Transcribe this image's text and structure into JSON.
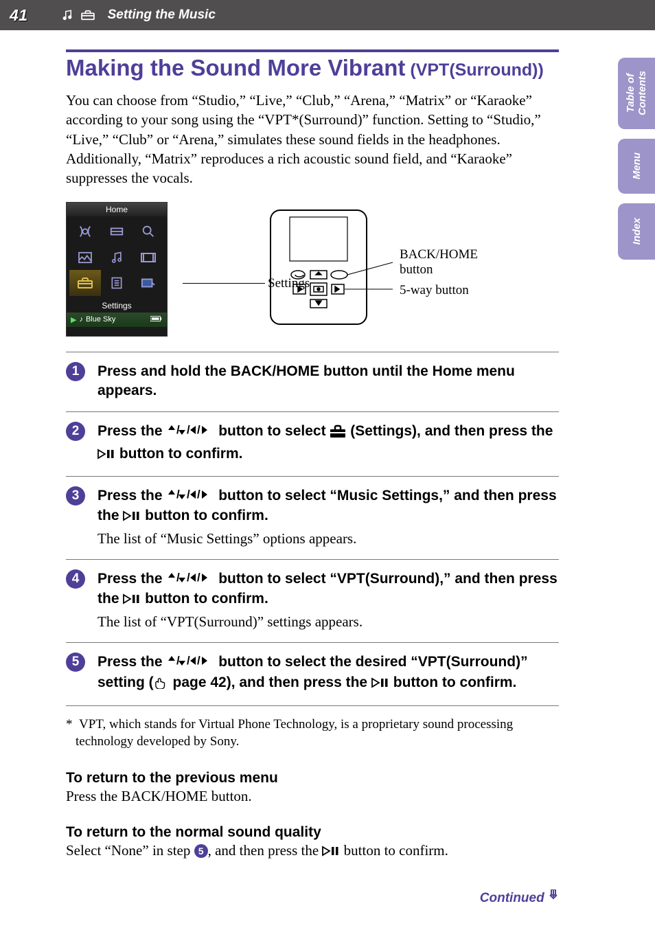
{
  "header": {
    "page_number": "41",
    "section": "Setting the Music"
  },
  "side_tabs": {
    "toc": "Table of Contents",
    "menu": "Menu",
    "index": "Index"
  },
  "main": {
    "heading_main": "Making the Sound More Vibrant",
    "heading_sub": " (VPT(Surround))",
    "intro": "You can choose from “Studio,” “Live,” “Club,” “Arena,” “Matrix” or “Karaoke” according to your song using the “VPT*(Surround)” function. Setting to “Studio,” “Live,” “Club” or “Arena,” simulates these sound fields in the headphones.\nAdditionally, “Matrix” reproduces a rich acoustic sound field, and “Karaoke” suppresses the vocals."
  },
  "figure": {
    "screen_title": "Home",
    "screen_caption": "Settings",
    "now_playing": "Blue Sky",
    "settings_label": "Settings",
    "labels": {
      "back_home": "BACK/HOME button",
      "five_way": "5-way button"
    }
  },
  "steps": [
    {
      "num": "1",
      "head": "Press and hold the BACK/HOME button until the Home menu appears.",
      "body": ""
    },
    {
      "num": "2",
      "head_pre": "Press the ",
      "head_mid": " button to select ",
      "head_post": " (Settings), and then press the ",
      "head_end": " button to confirm.",
      "body": ""
    },
    {
      "num": "3",
      "head_pre": "Press the ",
      "head_mid": " button to select “Music Settings,” and then press the ",
      "head_end": " button to confirm.",
      "body": "The list of “Music Settings” options appears."
    },
    {
      "num": "4",
      "head_pre": "Press the ",
      "head_mid": " button to select “VPT(Surround),” and then press the ",
      "head_end": " button to confirm.",
      "body": "The list of “VPT(Surround)” settings appears."
    },
    {
      "num": "5",
      "head_pre": "Press the ",
      "head_mid": " button to select the desired “VPT(Surround)” setting (",
      "head_page": " page 42), and then press the ",
      "head_end": " button to confirm.",
      "body": ""
    }
  ],
  "footnote": "* VPT, which stands for Virtual Phone Technology, is a proprietary sound processing technology developed by Sony.",
  "return_prev": {
    "h": "To return to the previous menu",
    "p": "Press the BACK/HOME button."
  },
  "return_normal": {
    "h": "To return to the normal sound quality",
    "p_pre": "Select “None” in step ",
    "p_num": "5",
    "p_mid": ", and then press the ",
    "p_end": " button to confirm."
  },
  "continued": "Continued"
}
